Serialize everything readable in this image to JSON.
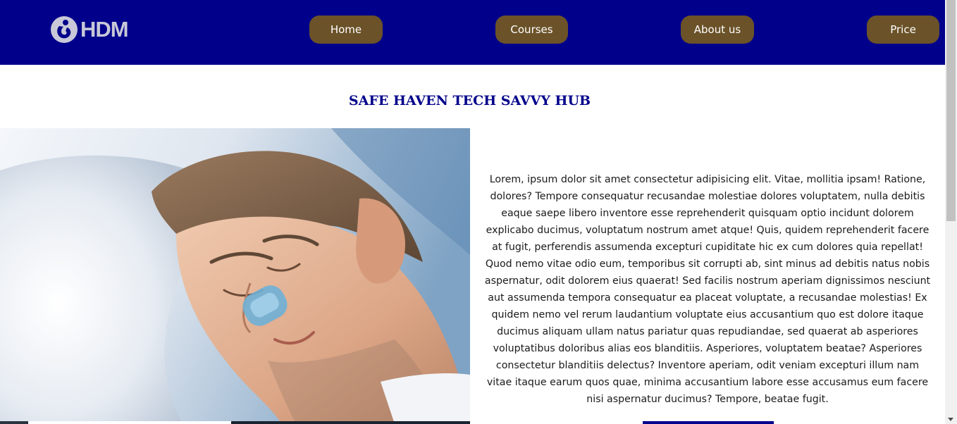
{
  "header": {
    "logo_text": "HDM",
    "nav": {
      "home": "Home",
      "courses": "Courses",
      "about": "About us",
      "price": "Price"
    }
  },
  "main": {
    "title": "SAFE HAVEN TECH SAVVY HUB",
    "paragraph": "Lorem, ipsum dolor sit amet consectetur adipisicing elit. Vitae, mollitia ipsam! Ratione, dolores? Tempore consequatur recusandae molestiae dolores voluptatem, nulla debitis eaque saepe libero inventore esse reprehenderit quisquam optio incidunt dolorem explicabo ducimus, voluptatum nostrum amet atque! Quis, quidem reprehenderit facere at fugit, perferendis assumenda excepturi cupiditate hic ex cum dolores quia repellat! Quod nemo vitae odio eum, temporibus sit corrupti ab, sint minus ad debitis natus nobis aspernatur, odit dolorem eius quaerat! Sed facilis nostrum aperiam dignissimos nesciunt aut assumenda tempora consequatur ea placeat voluptate, a recusandae molestias! Ex quidem nemo vel rerum laudantium voluptate eius accusantium quo est dolore itaque ducimus aliquam ullam natus pariatur quas repudiandae, sed quaerat ab asperiores voluptatibus doloribus alias eos blanditiis. Asperiores, voluptatem beatae? Asperiores consectetur blanditiis delectus? Inventore aperiam, odit veniam excepturi illum nam vitae itaque earum quos quae, minima accusantium labore esse accusamus eum facere nisi aspernatur ducimus? Tempore, beatae fugit."
  },
  "colors": {
    "navbar_bg": "#00008b",
    "nav_button_bg": "#6b5228",
    "title_color": "#00008b"
  },
  "icons": {
    "logo": "hdm-logo-icon"
  }
}
